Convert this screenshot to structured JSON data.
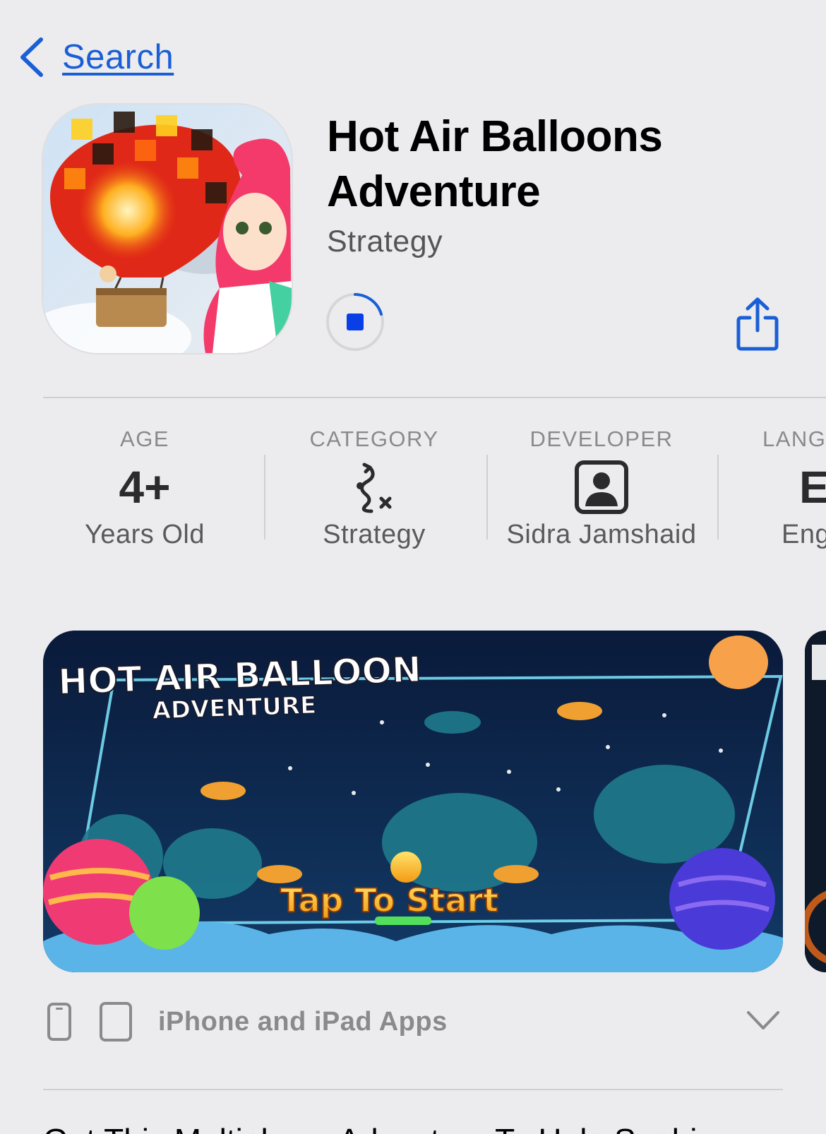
{
  "nav": {
    "back_label": "Search"
  },
  "app": {
    "title_line1": "Hot Air Balloons",
    "title_line2": "Adventure",
    "subtitle": "Strategy"
  },
  "info": {
    "age": {
      "caption": "AGE",
      "value": "4+",
      "sub": "Years Old"
    },
    "category": {
      "caption": "CATEGORY",
      "icon": "strategy-path-icon",
      "sub": "Strategy"
    },
    "developer": {
      "caption": "DEVELOPER",
      "icon": "person-square-icon",
      "sub": "Sidra Jamshaid"
    },
    "language": {
      "caption": "LANG",
      "value": "E",
      "sub": "Eng"
    }
  },
  "screenshot": {
    "title_line1": "HOT AIR BALLOON",
    "title_line2": "ADVENTURE",
    "cta": "Tap To Start"
  },
  "devices": {
    "label": "iPhone and iPad Apps"
  },
  "description_preview": "Get This Multiplayer Adventure To Help Sophia"
}
